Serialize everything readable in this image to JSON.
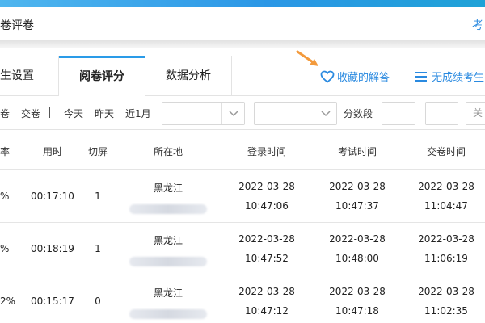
{
  "header": {
    "title": "卷评卷",
    "right_link": "考"
  },
  "tabs": [
    {
      "label": "考生设置"
    },
    {
      "label": "阅卷评分",
      "active": true
    },
    {
      "label": "数据分析"
    }
  ],
  "actions": {
    "favorites": "收藏的解答",
    "no_score": "无成绩考生"
  },
  "filters": {
    "items": [
      "卷",
      "交卷",
      "今天",
      "昨天",
      "近1月"
    ],
    "separator": "|",
    "score_range_label": "分数段",
    "close_label": "关"
  },
  "table": {
    "headers": [
      "率",
      "用时",
      "切屏",
      "所在地",
      "登录时间",
      "考试时间",
      "交卷时间"
    ],
    "rows": [
      {
        "rate": "%",
        "time": "00:17:10",
        "switch": "1",
        "location": "黑龙江",
        "login_date": "2022-03-28",
        "login_time": "10:47:06",
        "exam_date": "2022-03-28",
        "exam_time": "10:47:37",
        "submit_date": "2022-03-28",
        "submit_time": "11:04:47"
      },
      {
        "rate": "%",
        "time": "00:18:19",
        "switch": "1",
        "location": "黑龙江",
        "login_date": "2022-03-28",
        "login_time": "10:47:52",
        "exam_date": "2022-03-28",
        "exam_time": "10:48:00",
        "submit_date": "2022-03-28",
        "submit_time": "11:06:19"
      },
      {
        "rate": "2%",
        "time": "00:15:17",
        "switch": "0",
        "location": "黑龙江",
        "login_date": "2022-03-28",
        "login_time": "10:47:12",
        "exam_date": "2022-03-28",
        "exam_time": "10:47:18",
        "submit_date": "2022-03-28",
        "submit_time": "11:02:35"
      }
    ]
  },
  "colors": {
    "accent": "#2a8ae0",
    "arrow": "#f39a3c",
    "top_bar": "#2b97e6"
  },
  "icons": [
    "heart-icon",
    "list-icon",
    "chevron-down-icon",
    "arrow-pointer-icon"
  ]
}
